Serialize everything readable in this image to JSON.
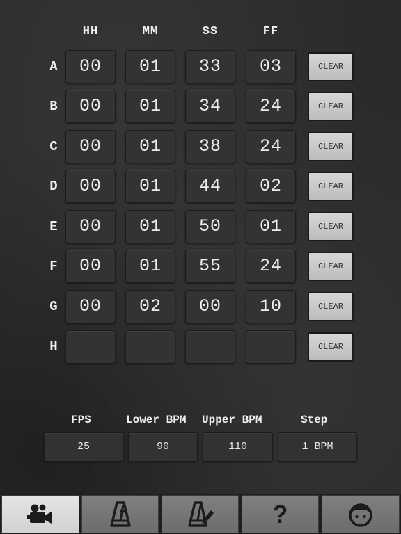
{
  "columns": [
    "HH",
    "MM",
    "SS",
    "FF"
  ],
  "rows": [
    {
      "label": "A",
      "hh": "00",
      "mm": "01",
      "ss": "33",
      "ff": "03"
    },
    {
      "label": "B",
      "hh": "00",
      "mm": "01",
      "ss": "34",
      "ff": "24"
    },
    {
      "label": "C",
      "hh": "00",
      "mm": "01",
      "ss": "38",
      "ff": "24"
    },
    {
      "label": "D",
      "hh": "00",
      "mm": "01",
      "ss": "44",
      "ff": "02"
    },
    {
      "label": "E",
      "hh": "00",
      "mm": "01",
      "ss": "50",
      "ff": "01"
    },
    {
      "label": "F",
      "hh": "00",
      "mm": "01",
      "ss": "55",
      "ff": "24"
    },
    {
      "label": "G",
      "hh": "00",
      "mm": "02",
      "ss": "00",
      "ff": "10"
    },
    {
      "label": "H",
      "hh": "",
      "mm": "",
      "ss": "",
      "ff": ""
    }
  ],
  "clear_label": "CLEAR",
  "settings": {
    "fps_label": "FPS",
    "fps_value": "25",
    "lower_label": "Lower BPM",
    "lower_value": "90",
    "upper_label": "Upper BPM",
    "upper_value": "110",
    "step_label": "Step",
    "step_value": "1 BPM"
  },
  "tabs": [
    {
      "icon": "video-camera-icon",
      "active": true
    },
    {
      "icon": "metronome-icon",
      "active": false
    },
    {
      "icon": "metronome-edit-icon",
      "active": false
    },
    {
      "icon": "help-icon",
      "active": false
    },
    {
      "icon": "face-icon",
      "active": false
    }
  ],
  "help_glyph": "?"
}
